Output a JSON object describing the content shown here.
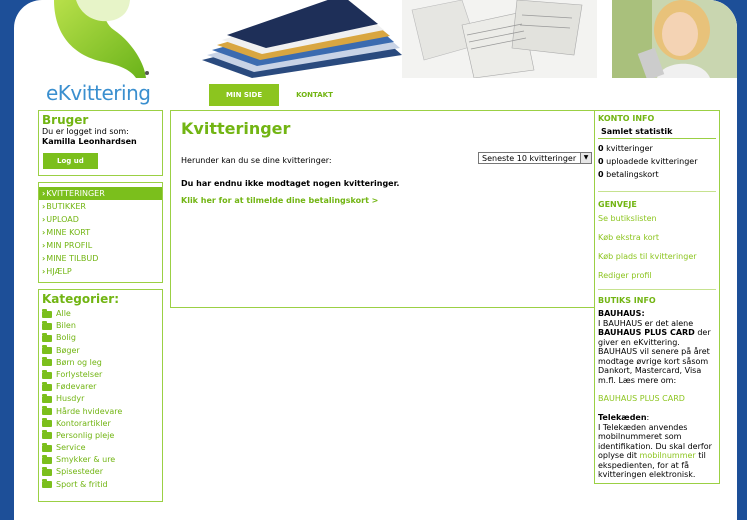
{
  "header": {
    "logo_text": "eKvittering"
  },
  "nav": {
    "tabs": [
      {
        "label": "MIN SIDE"
      },
      {
        "label": "KONTAKT"
      }
    ]
  },
  "user": {
    "title": "Bruger",
    "logged_in_as": "Du er logget ind som:",
    "name": "Kamilla Leonhardsen",
    "logout": "Log ud"
  },
  "menu": [
    {
      "label": "KVITTERINGER"
    },
    {
      "label": "BUTIKKER"
    },
    {
      "label": "UPLOAD"
    },
    {
      "label": "MINE KORT"
    },
    {
      "label": "MIN PROFIL"
    },
    {
      "label": "MINE TILBUD"
    },
    {
      "label": "HJÆLP"
    }
  ],
  "categories": {
    "title": "Kategorier:",
    "items": [
      {
        "label": "Alle"
      },
      {
        "label": "Bilen"
      },
      {
        "label": "Bolig"
      },
      {
        "label": "Bøger"
      },
      {
        "label": "Børn og leg"
      },
      {
        "label": "Forlystelser"
      },
      {
        "label": "Fødevarer"
      },
      {
        "label": "Husdyr"
      },
      {
        "label": "Hårde hvidevare"
      },
      {
        "label": "Kontorartikler"
      },
      {
        "label": "Personlig pleje"
      },
      {
        "label": "Service"
      },
      {
        "label": "Smykker & ure"
      },
      {
        "label": "Spisesteder"
      },
      {
        "label": "Sport & fritid"
      }
    ]
  },
  "main": {
    "title": "Kvitteringer",
    "intro": "Herunder kan du se dine kvitteringer:",
    "filter": "Seneste 10 kvitteringer",
    "empty": "Du har endnu ikke modtaget nogen kvitteringer.",
    "link": "Klik her for at tilmelde dine betalingskort >"
  },
  "konto": {
    "title": "KONTO INFO",
    "subtitle": "Samlet statistik",
    "stats": [
      {
        "count": "0",
        "label": " kvitteringer"
      },
      {
        "count": "0",
        "label": " uploadede kvitteringer"
      },
      {
        "count": "0",
        "label": " betalingskort"
      }
    ]
  },
  "genveje": {
    "title": "GENVEJE",
    "links": [
      "Se butikslisten",
      "Køb ekstra kort",
      "Køb plads til kvitteringer",
      "Rediger profil"
    ]
  },
  "butiks": {
    "title": "BUTIKS INFO",
    "store1_name": "BAUHAUS",
    "store1_text_a": "I BAUHAUS er det alene ",
    "store1_bold": "BAUHAUS PLUS CARD",
    "store1_text_b": " der giver en eKvittering. BAUHAUS vil senere på året modtage øvrige kort såsom Dankort, Mastercard, Visa m.fl. Læs mere om:",
    "store1_link": "BAUHAUS PLUS CARD",
    "store2_name": "Telekæden",
    "store2_text_a": "I Telekæden anvendes mobilnummeret som identifikation. Du skal derfor oplyse dit ",
    "store2_link": "mobilnummer",
    "store2_text_b": " til ekspedienten, for at få kvitteringen elektronisk."
  },
  "colors": {
    "brand_green": "#7bbf1c",
    "link_green": "#72b513",
    "page_blue": "#1d4f98",
    "logo_blue": "#3a8fcf"
  }
}
